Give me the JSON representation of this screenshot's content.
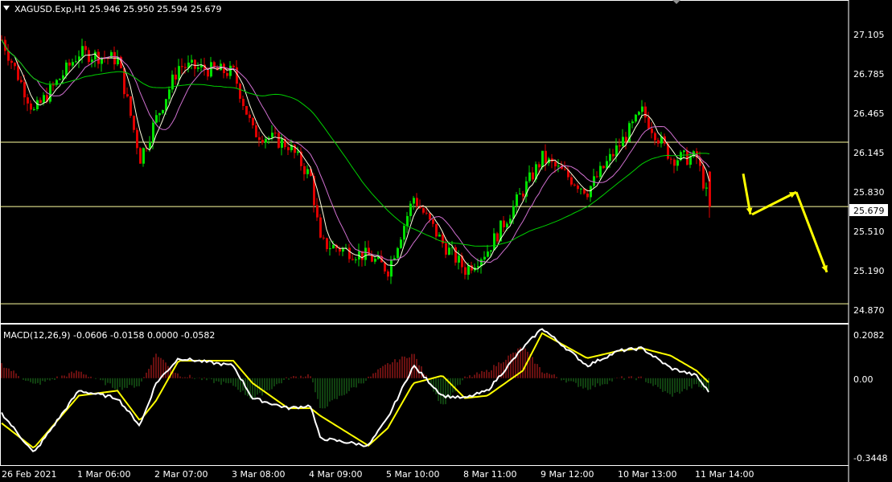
{
  "header": {
    "symbol_line": "XAGUSD.Exp,H1  25.946 25.950 25.594 25.679",
    "dropdown_icon": "triangle-down-icon"
  },
  "price_axis": {
    "ticks": [
      "27.105",
      "26.785",
      "26.465",
      "26.145",
      "25.830",
      "25.510",
      "25.190",
      "24.870"
    ],
    "current_price": "25.679"
  },
  "macd": {
    "label": "MACD(12,26,9) -0.0606 -0.0158 0.0000 -0.0582",
    "ticks": [
      "0.2082",
      "0.00",
      "-0.3448"
    ]
  },
  "time_axis": {
    "labels": [
      "26 Feb 2021",
      "1 Mar 06:00",
      "2 Mar 07:00",
      "3 Mar 08:00",
      "4 Mar 09:00",
      "5 Mar 10:00",
      "8 Mar 11:00",
      "9 Mar 12:00",
      "10 Mar 13:00",
      "11 Mar 14:00"
    ]
  },
  "colors": {
    "background": "#000000",
    "frame": "#ffffff",
    "bull_candle": "#00e000",
    "bear_candle": "#e00000",
    "ma_fast": "#ffffe0",
    "ma_mid": "#d070d0",
    "ma_slow": "#00d000",
    "level_line": "#ffffa0",
    "arrow": "#ffff00",
    "macd_line": "#ffffff",
    "signal_line": "#ffff00",
    "hist_pos": "#d02020",
    "hist_neg": "#208020"
  },
  "chart_data": {
    "type": "candlestick",
    "symbol": "XAGUSD.Exp",
    "timeframe": "H1",
    "ohlc_last": {
      "open": 25.946,
      "high": 25.95,
      "low": 25.594,
      "close": 25.679
    },
    "close_path": [
      {
        "time": "26 Feb 2021",
        "price": 26.95
      },
      {
        "time": "26 Feb 2021 +10h",
        "price": 26.4
      },
      {
        "time": "1 Mar 06:00",
        "price": 26.85
      },
      {
        "time": "1 Mar 18:00",
        "price": 26.8
      },
      {
        "time": "2 Mar 02:00",
        "price": 26.05
      },
      {
        "time": "2 Mar 07:00",
        "price": 26.35
      },
      {
        "time": "2 Mar 14:00",
        "price": 26.75
      },
      {
        "time": "3 Mar 08:00",
        "price": 26.7
      },
      {
        "time": "3 Mar 14:00",
        "price": 26.25
      },
      {
        "time": "4 Mar 02:00",
        "price": 26.15
      },
      {
        "time": "4 Mar 09:00",
        "price": 25.9
      },
      {
        "time": "4 Mar 12:00",
        "price": 25.4
      },
      {
        "time": "5 Mar 04:00",
        "price": 25.3
      },
      {
        "time": "5 Mar 10:00",
        "price": 25.2
      },
      {
        "time": "5 Mar 18:00",
        "price": 25.75
      },
      {
        "time": "8 Mar 04:00",
        "price": 25.4
      },
      {
        "time": "8 Mar 11:00",
        "price": 25.2
      },
      {
        "time": "8 Mar 18:00",
        "price": 25.35
      },
      {
        "time": "9 Mar 06:00",
        "price": 25.8
      },
      {
        "time": "9 Mar 12:00",
        "price": 26.05
      },
      {
        "time": "10 Mar 03:00",
        "price": 25.8
      },
      {
        "time": "10 Mar 13:00",
        "price": 26.15
      },
      {
        "time": "10 Mar 20:00",
        "price": 26.4
      },
      {
        "time": "11 Mar 06:00",
        "price": 26.05
      },
      {
        "time": "11 Mar 14:00",
        "price": 26.05
      },
      {
        "time": "11 Mar 18:00",
        "price": 25.68
      }
    ],
    "horizontal_levels": [
      26.17,
      25.68,
      24.94
    ],
    "forecast_arrow_prices": [
      25.93,
      25.62,
      25.79,
      25.18
    ],
    "macd_params": [
      12,
      26,
      9
    ],
    "macd_readout": {
      "macd": -0.0606,
      "signal": -0.0158,
      "value3": 0.0,
      "value4": -0.0582
    },
    "macd_ylim": [
      -0.3448,
      0.2082
    ],
    "price_ylim": [
      24.8,
      27.24
    ],
    "macd_path": [
      {
        "time": "26 Feb 2021",
        "macd": -0.14,
        "signal": -0.18
      },
      {
        "time": "26 Feb 2021 +10h",
        "macd": -0.3,
        "signal": -0.28
      },
      {
        "time": "1 Mar 06:00",
        "macd": -0.05,
        "signal": -0.07
      },
      {
        "time": "1 Mar 18:00",
        "macd": -0.08,
        "signal": -0.05
      },
      {
        "time": "2 Mar 02:00",
        "macd": -0.19,
        "signal": -0.17
      },
      {
        "time": "2 Mar 07:00",
        "macd": -0.02,
        "signal": -0.09
      },
      {
        "time": "2 Mar 14:00",
        "macd": 0.08,
        "signal": 0.07
      },
      {
        "time": "3 Mar 08:00",
        "macd": 0.05,
        "signal": 0.07
      },
      {
        "time": "3 Mar 14:00",
        "macd": -0.08,
        "signal": -0.02
      },
      {
        "time": "4 Mar 02:00",
        "macd": -0.12,
        "signal": -0.12
      },
      {
        "time": "4 Mar 09:00",
        "macd": -0.11,
        "signal": -0.12
      },
      {
        "time": "4 Mar 12:00",
        "macd": -0.24,
        "signal": -0.15
      },
      {
        "time": "5 Mar 04:00",
        "macd": -0.27,
        "signal": -0.27
      },
      {
        "time": "5 Mar 10:00",
        "macd": -0.16,
        "signal": -0.2
      },
      {
        "time": "5 Mar 18:00",
        "macd": 0.05,
        "signal": -0.02
      },
      {
        "time": "8 Mar 04:00",
        "macd": -0.07,
        "signal": 0.01
      },
      {
        "time": "8 Mar 11:00",
        "macd": -0.08,
        "signal": -0.08
      },
      {
        "time": "8 Mar 18:00",
        "macd": -0.05,
        "signal": -0.07
      },
      {
        "time": "9 Mar 06:00",
        "macd": 0.12,
        "signal": 0.03
      },
      {
        "time": "9 Mar 12:00",
        "macd": 0.2,
        "signal": 0.18
      },
      {
        "time": "10 Mar 03:00",
        "macd": 0.05,
        "signal": 0.08
      },
      {
        "time": "10 Mar 13:00",
        "macd": 0.11,
        "signal": 0.11
      },
      {
        "time": "10 Mar 20:00",
        "macd": 0.12,
        "signal": 0.12
      },
      {
        "time": "11 Mar 06:00",
        "macd": 0.04,
        "signal": 0.09
      },
      {
        "time": "11 Mar 14:00",
        "macd": 0.01,
        "signal": 0.03
      },
      {
        "time": "11 Mar 18:00",
        "macd": -0.06,
        "signal": -0.02
      }
    ]
  }
}
